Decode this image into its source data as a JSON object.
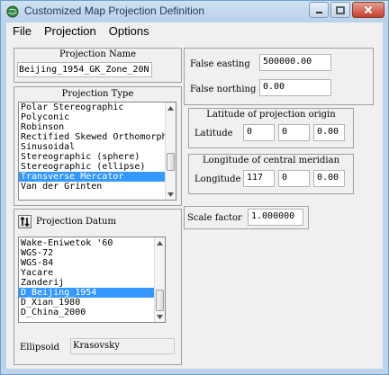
{
  "window": {
    "title": "Customized Map Projection Definition"
  },
  "menu": [
    "File",
    "Projection",
    "Options"
  ],
  "projection_name": {
    "title": "Projection Name",
    "value": "Beijing_1954_GK_Zone_20N"
  },
  "projection_type": {
    "title": "Projection Type",
    "items": [
      "Polar Stereographic",
      "Polyconic",
      "Robinson",
      "Rectified Skewed Orthomorphic",
      "Sinusoidal",
      "Stereographic (sphere)",
      "Stereographic (ellipse)",
      "Transverse Mercator",
      "Van der Grinten"
    ],
    "selected": "Transverse Mercator"
  },
  "datum": {
    "title": "Projection Datum",
    "items": [
      "Wake-Eniwetok '60",
      "WGS-72",
      "WGS-84",
      "Yacare",
      "Zanderij",
      "D_Beijing_1954",
      "D_Xian_1980",
      "D_China_2000"
    ],
    "selected": "D_Beijing_1954",
    "ellipsoid_label": "Ellipsoid",
    "ellipsoid_value": "Krasovsky"
  },
  "false_easting": {
    "label": "False easting",
    "value": "500000.00"
  },
  "false_northing": {
    "label": "False northing",
    "value": "0.00"
  },
  "lat_origin": {
    "title": "Latitude of projection origin",
    "label": "Latitude",
    "deg": "0",
    "min": "0",
    "sec": "0.00"
  },
  "central_meridian": {
    "title": "Longitude of central meridian",
    "label": "Longitude",
    "deg": "117",
    "min": "0",
    "sec": "0.00"
  },
  "scale_factor": {
    "label": "Scale factor",
    "value": "1.000000"
  },
  "colors": {
    "titlebar": "#bcd3ea",
    "selection": "#3399ff",
    "close": "#c4402a"
  }
}
